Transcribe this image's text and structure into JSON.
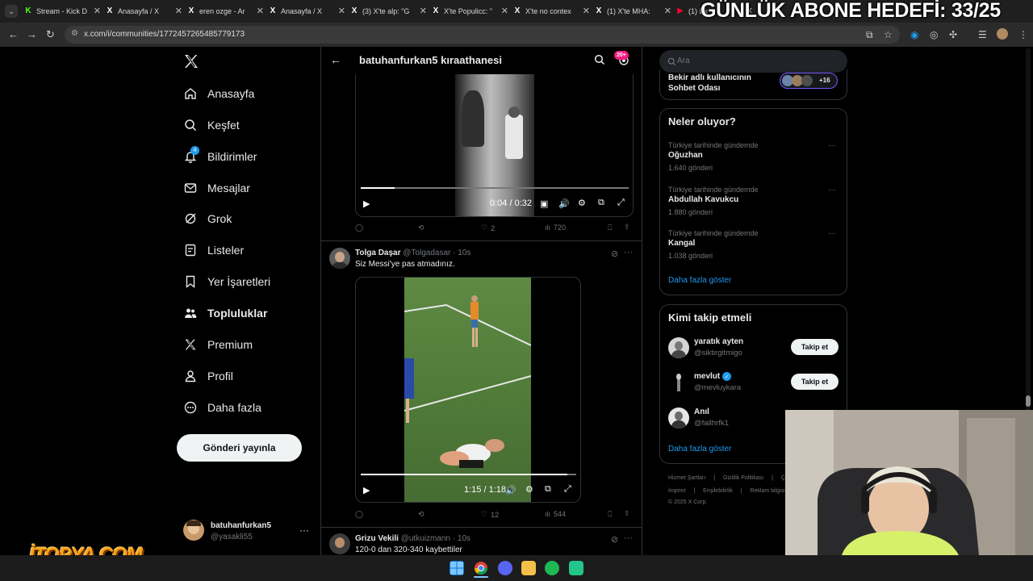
{
  "browser": {
    "tabs": [
      {
        "label": "Stream - Kick D",
        "favicon": "K",
        "color": "#53fc18"
      },
      {
        "label": "Anasayfa / X",
        "favicon": "X",
        "color": "#ffffff"
      },
      {
        "label": "eren ozge - Ar",
        "favicon": "X",
        "color": "#ffffff"
      },
      {
        "label": "Anasayfa / X",
        "favicon": "X",
        "color": "#ffffff"
      },
      {
        "label": "(3) X'te alp: \"G",
        "favicon": "X",
        "color": "#ffffff"
      },
      {
        "label": "X'te Populicc: \"",
        "favicon": "X",
        "color": "#ffffff"
      },
      {
        "label": "X'te no contex",
        "favicon": "X",
        "color": "#ffffff"
      },
      {
        "label": "(1) X'te MHA:",
        "favicon": "X",
        "color": "#ffffff"
      },
      {
        "label": "(1) Ek",
        "favicon": "▶",
        "color": "#ff0033"
      }
    ],
    "url": "x.com/i/communities/1772457265485779173"
  },
  "overlay": {
    "goal_text": "GÜNLÜK ABONE HEDEFİ: 33/25",
    "logo_text": "İTOPYA.COM"
  },
  "nav": {
    "items": [
      {
        "label": "Anasayfa",
        "icon": "home-icon"
      },
      {
        "label": "Keşfet",
        "icon": "search-icon"
      },
      {
        "label": "Bildirimler",
        "icon": "bell-icon",
        "badge": "4"
      },
      {
        "label": "Mesajlar",
        "icon": "mail-icon"
      },
      {
        "label": "Grok",
        "icon": "grok-icon"
      },
      {
        "label": "Listeler",
        "icon": "list-icon"
      },
      {
        "label": "Yer İşaretleri",
        "icon": "bookmark-icon"
      },
      {
        "label": "Topluluklar",
        "icon": "communities-icon",
        "active": true
      },
      {
        "label": "Premium",
        "icon": "x-logo-icon"
      },
      {
        "label": "Profil",
        "icon": "person-icon"
      },
      {
        "label": "Daha fazla",
        "icon": "more-circle-icon"
      }
    ],
    "post_button": "Gönderi yayınla",
    "account": {
      "name": "batuhanfurkan5",
      "handle": "@yasakli55"
    }
  },
  "header": {
    "title": "batuhanfurkan5 kıraathanesi",
    "badge": "20+"
  },
  "posts": [
    {
      "video": {
        "time": "0:04 / 0:32",
        "progress": 0.125
      },
      "actions": {
        "replies": "",
        "reposts": "",
        "likes": "2",
        "views": "720"
      }
    },
    {
      "author": "Tolga Daşar",
      "handle": "@Tolgadasar",
      "time": "10s",
      "text": "Siz Messi'ye pas atmadınız.",
      "video": {
        "time": "1:15 / 1:18",
        "progress": 0.96
      },
      "actions": {
        "replies": "",
        "reposts": "",
        "likes": "12",
        "views": "544"
      }
    },
    {
      "author": "Grizu Vekili",
      "handle": "@utkuizmann",
      "time": "10s",
      "text": "120-0 dan 320-340 kaybettiler"
    }
  ],
  "right": {
    "search_placeholder": "Ara",
    "chat": {
      "title_line1": "Bekir adlı kullanıcının",
      "title_line2": "Sohbet Odası",
      "extra": "+16"
    },
    "trends": {
      "title": "Neler oluyor?",
      "items": [
        {
          "meta": "Türkiye tarihinde gündemde",
          "name": "Oğuzhan",
          "count": "1.640 gönderi"
        },
        {
          "meta": "Türkiye tarihinde gündemde",
          "name": "Abdullah Kavukcu",
          "count": "1.880 gönderi"
        },
        {
          "meta": "Türkiye tarihinde gündemde",
          "name": "Kangal",
          "count": "1.038 gönderi"
        }
      ],
      "more": "Daha fazla göster"
    },
    "who": {
      "title": "Kimi takip etmeli",
      "items": [
        {
          "name": "yaratık ayten",
          "handle": "@siktirgitmigo",
          "button": "Takip et"
        },
        {
          "name": "mevlut",
          "handle": "@mevluykara",
          "button": "Takip et",
          "verified": true
        },
        {
          "name": "Anıl",
          "handle": "@fallhrfk1",
          "button": ""
        }
      ],
      "more": "Daha fazla göster"
    },
    "footer": {
      "l1": [
        "Hizmet Şartları",
        "Gizlilik Politikası",
        "Çe"
      ],
      "l2": [
        "İmprint",
        "Erişilebilirlik",
        "Reklam bilgisi"
      ],
      "copy": "© 2025 X Corp."
    }
  },
  "colors": {
    "accent": "#1d9bf0",
    "bg": "#000000",
    "border": "#2f3336",
    "muted": "#71767b"
  }
}
